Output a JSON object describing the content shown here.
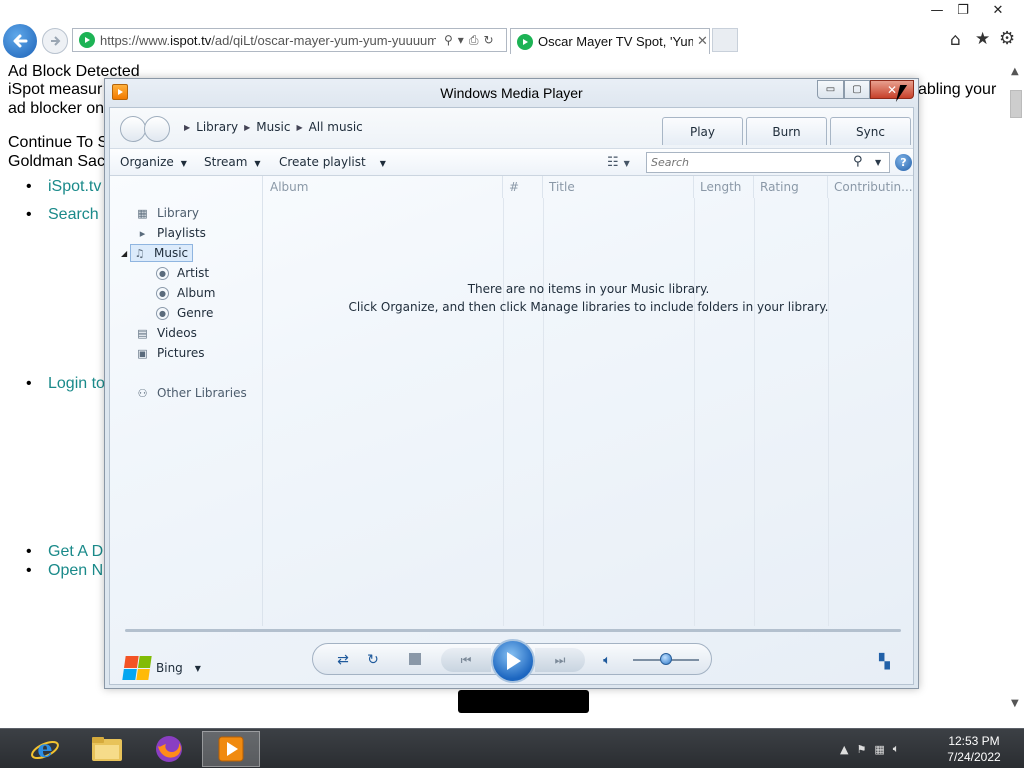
{
  "ie": {
    "caption": {
      "minimize": "—",
      "maximize": "❐",
      "close": "✕"
    },
    "address": {
      "url_prefix": "https://www.",
      "url_domain": "ispot.tv",
      "url_path": "/ad/qiLt/oscar-mayer-yum-yum-yuuuum"
    },
    "tab": {
      "title": "Oscar Mayer TV Spot, 'Yum...",
      "close": "✕"
    },
    "icons": [
      "back-icon",
      "forward-icon",
      "search-icon",
      "compat-icon",
      "refresh-icon",
      "home-icon",
      "favorites-icon",
      "tools-icon"
    ]
  },
  "webpage": {
    "heading": "Ad Block Detected",
    "message_line1": "iSpot measur",
    "message_line1_right": "abling your",
    "message_line2": "ad blocker on",
    "continue_link": "Continue To S",
    "goldman": "Goldman Sac",
    "list_items": [
      "iSpot.tv",
      "Search",
      "Login to",
      "Get A D",
      "Open N"
    ]
  },
  "wmp": {
    "title": "Windows Media Player",
    "caption": {
      "minimize": "▭",
      "maximize": "▢",
      "close": "✕"
    },
    "breadcrumb": [
      "Library",
      "Music",
      "All music"
    ],
    "tabs": {
      "play": "Play",
      "burn": "Burn",
      "sync": "Sync"
    },
    "commands": {
      "organize": "Organize",
      "stream": "Stream",
      "create_playlist": "Create playlist"
    },
    "search": {
      "placeholder": "Search"
    },
    "help": "?",
    "nav": {
      "library": "Library",
      "playlists": "Playlists",
      "music": "Music",
      "artist": "Artist",
      "album": "Album",
      "genre": "Genre",
      "videos": "Videos",
      "pictures": "Pictures",
      "other_libraries": "Other Libraries",
      "bing": "Bing"
    },
    "columns": [
      "Album",
      "#",
      "Title",
      "Length",
      "Rating",
      "Contributin..."
    ],
    "empty_message": {
      "line1": "There are no items in your Music library.",
      "line2": "Click Organize, and then click Manage libraries to include folders in your library."
    },
    "volume_level": 0.5
  },
  "taskbar": {
    "clock_time": "12:53 PM",
    "clock_date": "7/24/2022"
  }
}
